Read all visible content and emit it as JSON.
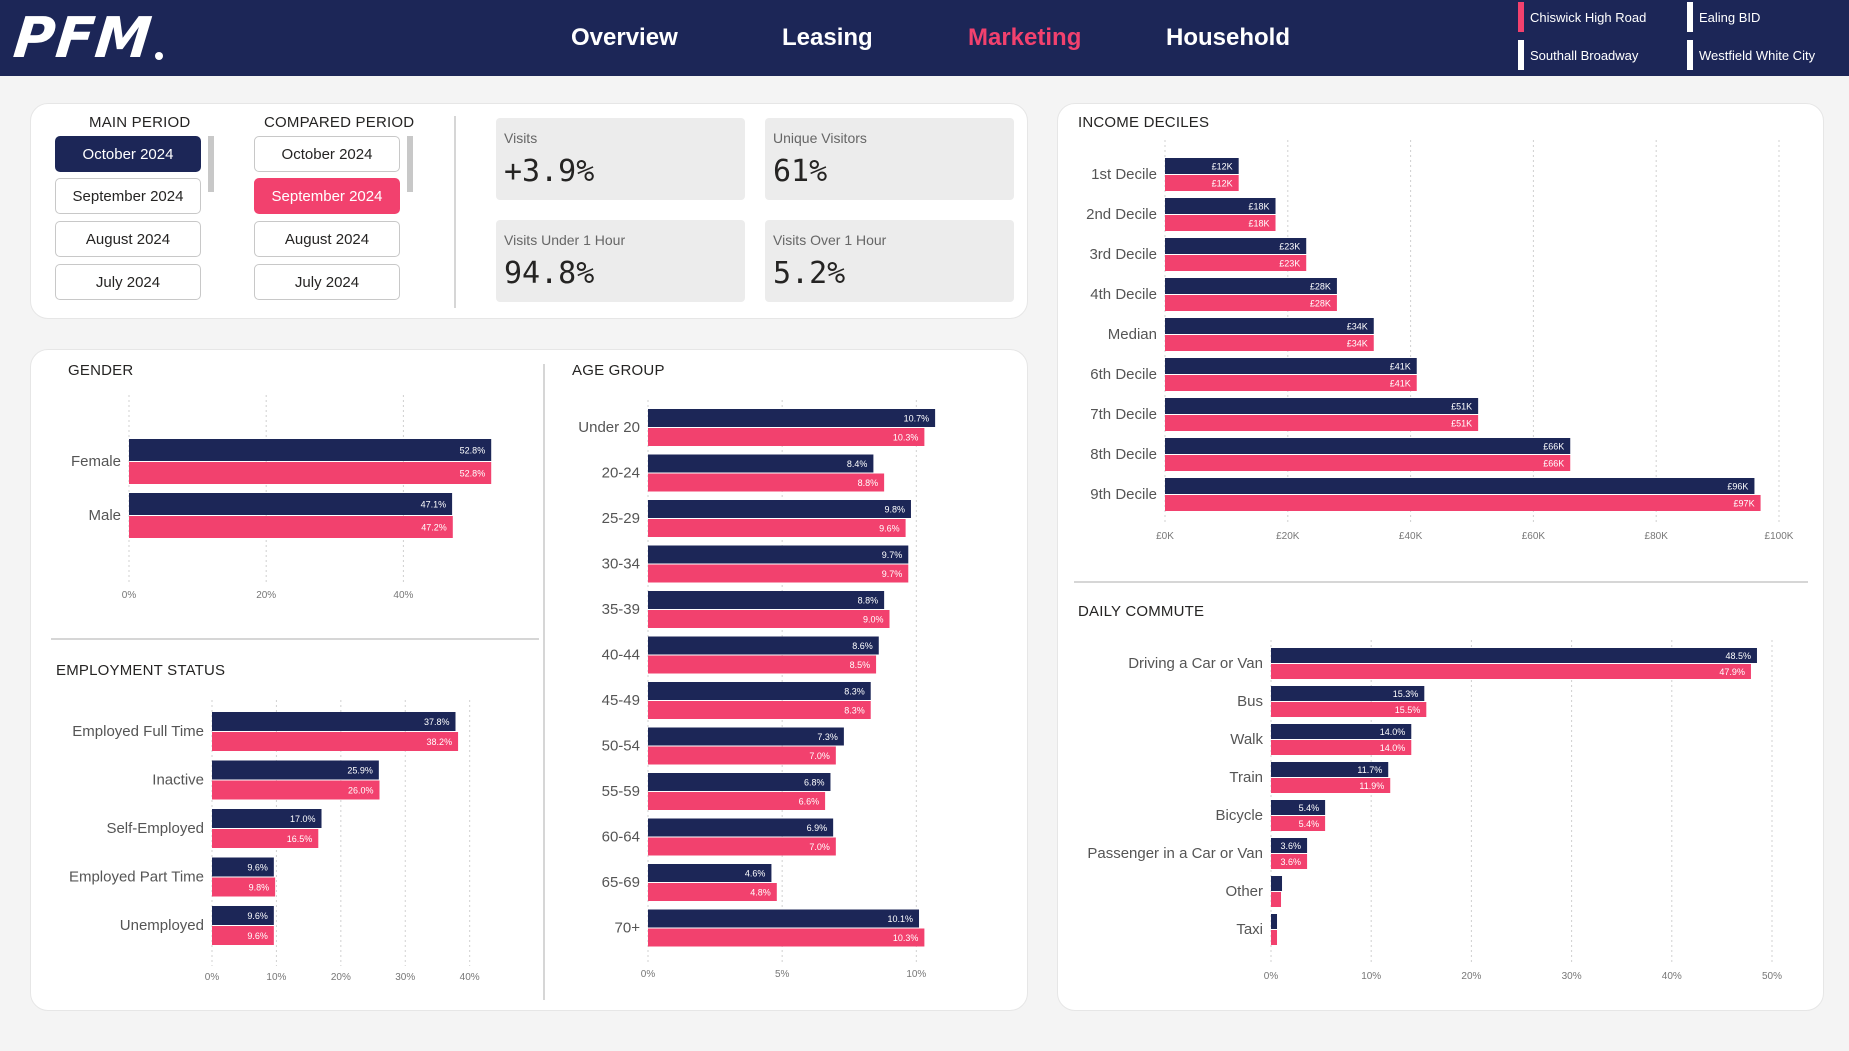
{
  "header": {
    "logo": "PFM",
    "nav": [
      {
        "label": "Overview",
        "active": false
      },
      {
        "label": "Leasing",
        "active": false
      },
      {
        "label": "Marketing",
        "active": true
      },
      {
        "label": "Household",
        "active": false
      }
    ],
    "locations": [
      {
        "label": "Chiswick High Road",
        "color": "#f2416e"
      },
      {
        "label": "Ealing BID",
        "color": "#ffffff"
      },
      {
        "label": "Southall Broadway",
        "color": "#ffffff"
      },
      {
        "label": "Westfield White City",
        "color": "#ffffff"
      }
    ]
  },
  "periods": {
    "main_title": "MAIN PERIOD",
    "compared_title": "COMPARED PERIOD",
    "main": [
      "October 2024",
      "September 2024",
      "August 2024",
      "July 2024"
    ],
    "main_selected": "October 2024",
    "compared": [
      "October 2024",
      "September 2024",
      "August 2024",
      "July 2024"
    ],
    "compared_selected": "September 2024"
  },
  "kpis": [
    {
      "label": "Visits",
      "value": "+3.9%"
    },
    {
      "label": "Unique Visitors",
      "value": "61%"
    },
    {
      "label": "Visits Under 1 Hour",
      "value": "94.8%"
    },
    {
      "label": "Visits Over 1 Hour",
      "value": "5.2%"
    }
  ],
  "colors": {
    "main": "#1c2657",
    "compared": "#f2416e"
  },
  "chart_data": [
    {
      "id": "gender",
      "type": "bar",
      "title": "GENDER",
      "categories": [
        "Female",
        "Male"
      ],
      "series": [
        {
          "values": [
            52.8,
            47.1
          ],
          "labels": [
            "52.8%",
            "47.1%"
          ]
        },
        {
          "values": [
            52.8,
            47.2
          ],
          "labels": [
            "52.8%",
            "47.2%"
          ]
        }
      ],
      "xlim": [
        0,
        50
      ],
      "ticks": [
        0,
        20,
        40
      ],
      "tick_labels": [
        "0%",
        "20%",
        "40%"
      ]
    },
    {
      "id": "employment",
      "type": "bar",
      "title": "EMPLOYMENT STATUS",
      "categories": [
        "Employed Full Time",
        "Inactive",
        "Self-Employed",
        "Employed Part Time",
        "Unemployed"
      ],
      "series": [
        {
          "values": [
            37.8,
            25.9,
            17.0,
            9.6,
            9.6
          ],
          "labels": [
            "37.8%",
            "25.9%",
            "17.0%",
            "9.6%",
            "9.6%"
          ]
        },
        {
          "values": [
            38.2,
            26.0,
            16.5,
            9.8,
            9.6
          ],
          "labels": [
            "38.2%",
            "26.0%",
            "16.5%",
            "9.8%",
            "9.6%"
          ]
        }
      ],
      "xlim": [
        0,
        43
      ],
      "ticks": [
        0,
        10,
        20,
        30,
        40
      ],
      "tick_labels": [
        "0%",
        "10%",
        "20%",
        "30%",
        "40%"
      ]
    },
    {
      "id": "age",
      "type": "bar",
      "title": "AGE GROUP",
      "categories": [
        "Under 20",
        "20-24",
        "25-29",
        "30-34",
        "35-39",
        "40-44",
        "45-49",
        "50-54",
        "55-59",
        "60-64",
        "65-69",
        "70+"
      ],
      "series": [
        {
          "values": [
            10.7,
            8.4,
            9.8,
            9.7,
            8.8,
            8.6,
            8.3,
            7.3,
            6.8,
            6.9,
            4.6,
            10.1
          ],
          "labels": [
            "10.7%",
            "8.4%",
            "9.8%",
            "9.7%",
            "8.8%",
            "8.6%",
            "8.3%",
            "7.3%",
            "6.8%",
            "6.9%",
            "4.6%",
            "10.1%"
          ]
        },
        {
          "values": [
            10.3,
            8.8,
            9.6,
            9.7,
            9.0,
            8.5,
            8.3,
            7.0,
            6.6,
            7.0,
            4.8,
            10.3
          ],
          "labels": [
            "10.3%",
            "8.8%",
            "9.6%",
            "9.7%",
            "9.0%",
            "8.5%",
            "8.3%",
            "7.0%",
            "6.6%",
            "7.0%",
            "4.8%",
            "10.3%"
          ]
        }
      ],
      "xlim": [
        0,
        12
      ],
      "ticks": [
        0,
        5,
        10
      ],
      "tick_labels": [
        "0%",
        "5%",
        "10%"
      ]
    },
    {
      "id": "income",
      "type": "bar",
      "title": "INCOME DECILES",
      "categories": [
        "1st Decile",
        "2nd Decile",
        "3rd Decile",
        "4th Decile",
        "Median",
        "6th Decile",
        "7th Decile",
        "8th Decile",
        "9th Decile"
      ],
      "series": [
        {
          "values": [
            12,
            18,
            23,
            28,
            34,
            41,
            51,
            66,
            96
          ],
          "labels": [
            "£12K",
            "£18K",
            "£23K",
            "£28K",
            "£34K",
            "£41K",
            "£51K",
            "£66K",
            "£96K"
          ]
        },
        {
          "values": [
            12,
            18,
            23,
            28,
            34,
            41,
            51,
            66,
            97
          ],
          "labels": [
            "£12K",
            "£18K",
            "£23K",
            "£28K",
            "£34K",
            "£41K",
            "£51K",
            "£66K",
            "£97K"
          ]
        }
      ],
      "xlim": [
        0,
        100
      ],
      "ticks": [
        0,
        20,
        40,
        60,
        80,
        100
      ],
      "tick_labels": [
        "£0K",
        "£20K",
        "£40K",
        "£60K",
        "£80K",
        "£100K"
      ]
    },
    {
      "id": "commute",
      "type": "bar",
      "title": "DAILY COMMUTE",
      "categories": [
        "Driving a Car or Van",
        "Bus",
        "Walk",
        "Train",
        "Bicycle",
        "Passenger in a Car or Van",
        "Other",
        "Taxi"
      ],
      "series": [
        {
          "values": [
            48.5,
            15.3,
            14.0,
            11.7,
            5.4,
            3.6,
            1.1,
            0.6
          ],
          "labels": [
            "48.5%",
            "15.3%",
            "14.0%",
            "11.7%",
            "5.4%",
            "3.6%",
            "",
            ""
          ]
        },
        {
          "values": [
            47.9,
            15.5,
            14.0,
            11.9,
            5.4,
            3.6,
            1.0,
            0.6
          ],
          "labels": [
            "47.9%",
            "15.5%",
            "14.0%",
            "11.9%",
            "5.4%",
            "3.6%",
            "",
            ""
          ]
        }
      ],
      "xlim": [
        0,
        50
      ],
      "ticks": [
        0,
        10,
        20,
        30,
        40,
        50
      ],
      "tick_labels": [
        "0%",
        "10%",
        "20%",
        "30%",
        "40%",
        "50%"
      ]
    }
  ]
}
